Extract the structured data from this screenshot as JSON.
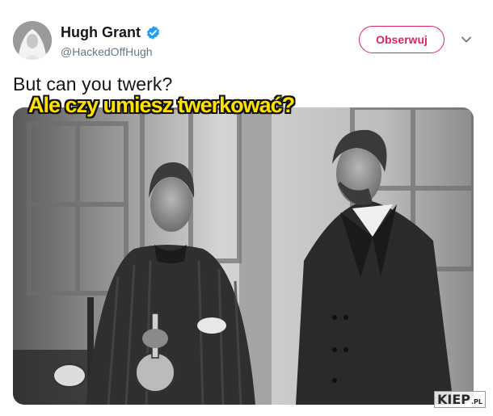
{
  "author": {
    "name": "Hugh Grant",
    "handle": "@HackedOffHugh",
    "verified_icon": "verified-badge-icon",
    "avatar": "profile-avatar"
  },
  "actions": {
    "follow_label": "Obserwuj",
    "more_icon": "chevron-down-icon"
  },
  "tweet": {
    "text": "But can you twerk?"
  },
  "media": {
    "caption": "Ale czy umiesz twerkować?",
    "watermark_main": "KIEP",
    "watermark_suffix": ".PL"
  },
  "colors": {
    "follow_accent": "#e0245e",
    "verified": "#1da1f2",
    "caption_fill": "#ffe100"
  }
}
